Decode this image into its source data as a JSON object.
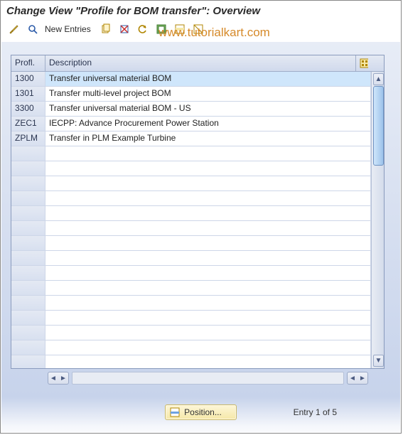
{
  "title": "Change View \"Profile for BOM transfer\": Overview",
  "watermark": "www.tutorialkart.com",
  "toolbar": {
    "new_entries_label": "New Entries"
  },
  "table": {
    "columns": {
      "profl": "Profl.",
      "desc": "Description"
    },
    "rows": [
      {
        "profl": "1300",
        "desc": "Transfer universal material BOM",
        "selected": true
      },
      {
        "profl": "1301",
        "desc": "Transfer multi-level project BOM"
      },
      {
        "profl": "3300",
        "desc": "Transfer universal material BOM - US"
      },
      {
        "profl": "ZEC1",
        "desc": "IECPP: Advance Procurement Power Station"
      },
      {
        "profl": "ZPLM",
        "desc": "Transfer in PLM Example Turbine"
      }
    ]
  },
  "footer": {
    "position_label": "Position...",
    "status": "Entry 1 of 5"
  }
}
